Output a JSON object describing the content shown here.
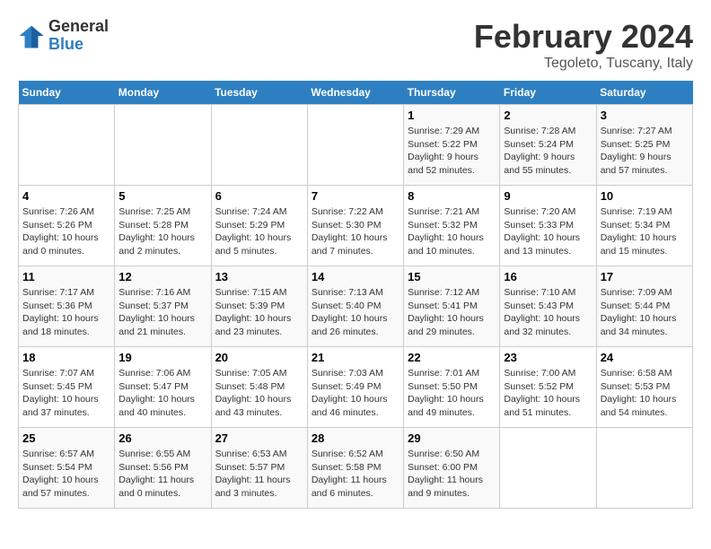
{
  "header": {
    "logo": {
      "general": "General",
      "blue": "Blue"
    },
    "title": "February 2024",
    "subtitle": "Tegoleto, Tuscany, Italy"
  },
  "calendar": {
    "weekdays": [
      "Sunday",
      "Monday",
      "Tuesday",
      "Wednesday",
      "Thursday",
      "Friday",
      "Saturday"
    ],
    "weeks": [
      [
        {
          "day": "",
          "content": ""
        },
        {
          "day": "",
          "content": ""
        },
        {
          "day": "",
          "content": ""
        },
        {
          "day": "",
          "content": ""
        },
        {
          "day": "1",
          "content": "Sunrise: 7:29 AM\nSunset: 5:22 PM\nDaylight: 9 hours\nand 52 minutes."
        },
        {
          "day": "2",
          "content": "Sunrise: 7:28 AM\nSunset: 5:24 PM\nDaylight: 9 hours\nand 55 minutes."
        },
        {
          "day": "3",
          "content": "Sunrise: 7:27 AM\nSunset: 5:25 PM\nDaylight: 9 hours\nand 57 minutes."
        }
      ],
      [
        {
          "day": "4",
          "content": "Sunrise: 7:26 AM\nSunset: 5:26 PM\nDaylight: 10 hours\nand 0 minutes."
        },
        {
          "day": "5",
          "content": "Sunrise: 7:25 AM\nSunset: 5:28 PM\nDaylight: 10 hours\nand 2 minutes."
        },
        {
          "day": "6",
          "content": "Sunrise: 7:24 AM\nSunset: 5:29 PM\nDaylight: 10 hours\nand 5 minutes."
        },
        {
          "day": "7",
          "content": "Sunrise: 7:22 AM\nSunset: 5:30 PM\nDaylight: 10 hours\nand 7 minutes."
        },
        {
          "day": "8",
          "content": "Sunrise: 7:21 AM\nSunset: 5:32 PM\nDaylight: 10 hours\nand 10 minutes."
        },
        {
          "day": "9",
          "content": "Sunrise: 7:20 AM\nSunset: 5:33 PM\nDaylight: 10 hours\nand 13 minutes."
        },
        {
          "day": "10",
          "content": "Sunrise: 7:19 AM\nSunset: 5:34 PM\nDaylight: 10 hours\nand 15 minutes."
        }
      ],
      [
        {
          "day": "11",
          "content": "Sunrise: 7:17 AM\nSunset: 5:36 PM\nDaylight: 10 hours\nand 18 minutes."
        },
        {
          "day": "12",
          "content": "Sunrise: 7:16 AM\nSunset: 5:37 PM\nDaylight: 10 hours\nand 21 minutes."
        },
        {
          "day": "13",
          "content": "Sunrise: 7:15 AM\nSunset: 5:39 PM\nDaylight: 10 hours\nand 23 minutes."
        },
        {
          "day": "14",
          "content": "Sunrise: 7:13 AM\nSunset: 5:40 PM\nDaylight: 10 hours\nand 26 minutes."
        },
        {
          "day": "15",
          "content": "Sunrise: 7:12 AM\nSunset: 5:41 PM\nDaylight: 10 hours\nand 29 minutes."
        },
        {
          "day": "16",
          "content": "Sunrise: 7:10 AM\nSunset: 5:43 PM\nDaylight: 10 hours\nand 32 minutes."
        },
        {
          "day": "17",
          "content": "Sunrise: 7:09 AM\nSunset: 5:44 PM\nDaylight: 10 hours\nand 34 minutes."
        }
      ],
      [
        {
          "day": "18",
          "content": "Sunrise: 7:07 AM\nSunset: 5:45 PM\nDaylight: 10 hours\nand 37 minutes."
        },
        {
          "day": "19",
          "content": "Sunrise: 7:06 AM\nSunset: 5:47 PM\nDaylight: 10 hours\nand 40 minutes."
        },
        {
          "day": "20",
          "content": "Sunrise: 7:05 AM\nSunset: 5:48 PM\nDaylight: 10 hours\nand 43 minutes."
        },
        {
          "day": "21",
          "content": "Sunrise: 7:03 AM\nSunset: 5:49 PM\nDaylight: 10 hours\nand 46 minutes."
        },
        {
          "day": "22",
          "content": "Sunrise: 7:01 AM\nSunset: 5:50 PM\nDaylight: 10 hours\nand 49 minutes."
        },
        {
          "day": "23",
          "content": "Sunrise: 7:00 AM\nSunset: 5:52 PM\nDaylight: 10 hours\nand 51 minutes."
        },
        {
          "day": "24",
          "content": "Sunrise: 6:58 AM\nSunset: 5:53 PM\nDaylight: 10 hours\nand 54 minutes."
        }
      ],
      [
        {
          "day": "25",
          "content": "Sunrise: 6:57 AM\nSunset: 5:54 PM\nDaylight: 10 hours\nand 57 minutes."
        },
        {
          "day": "26",
          "content": "Sunrise: 6:55 AM\nSunset: 5:56 PM\nDaylight: 11 hours\nand 0 minutes."
        },
        {
          "day": "27",
          "content": "Sunrise: 6:53 AM\nSunset: 5:57 PM\nDaylight: 11 hours\nand 3 minutes."
        },
        {
          "day": "28",
          "content": "Sunrise: 6:52 AM\nSunset: 5:58 PM\nDaylight: 11 hours\nand 6 minutes."
        },
        {
          "day": "29",
          "content": "Sunrise: 6:50 AM\nSunset: 6:00 PM\nDaylight: 11 hours\nand 9 minutes."
        },
        {
          "day": "",
          "content": ""
        },
        {
          "day": "",
          "content": ""
        }
      ]
    ]
  }
}
